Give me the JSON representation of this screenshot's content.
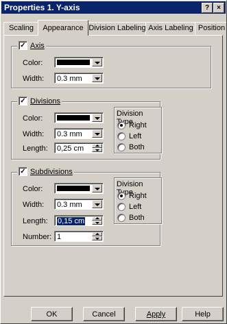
{
  "window": {
    "title": "Properties 1. Y-axis",
    "help_glyph": "?",
    "close_glyph": "×"
  },
  "tabs": [
    {
      "label": "Scaling",
      "active": false
    },
    {
      "label": "Appearance",
      "active": true
    },
    {
      "label": "Division Labeling",
      "active": false
    },
    {
      "label": "Axis Labeling",
      "active": false
    },
    {
      "label": "Position",
      "active": false
    }
  ],
  "axis": {
    "checked": true,
    "label": "Axis",
    "color_label": "Color:",
    "color_value": "#000000",
    "width_label": "Width:",
    "width_value": "0.3 mm"
  },
  "divisions": {
    "checked": true,
    "label": "Divisions",
    "color_label": "Color:",
    "color_value": "#000000",
    "width_label": "Width:",
    "width_value": "0.3 mm",
    "length_label": "Length:",
    "length_value": "0,25 cm",
    "type_title": "Division Type",
    "options": [
      "Right",
      "Left",
      "Both"
    ],
    "selected": "Right"
  },
  "subdivisions": {
    "checked": true,
    "label": "Subdivisions",
    "color_label": "Color:",
    "color_value": "#000000",
    "width_label": "Width:",
    "width_value": "0.3 mm",
    "length_label": "Length:",
    "length_value": "0,15 cm",
    "number_label": "Number:",
    "number_value": "1",
    "type_title": "Division Type",
    "options": [
      "Right",
      "Left",
      "Both"
    ],
    "selected": "Right"
  },
  "buttons": {
    "ok": "OK",
    "cancel": "Cancel",
    "apply": "Apply",
    "help": "Help"
  },
  "checkmark": "✓"
}
